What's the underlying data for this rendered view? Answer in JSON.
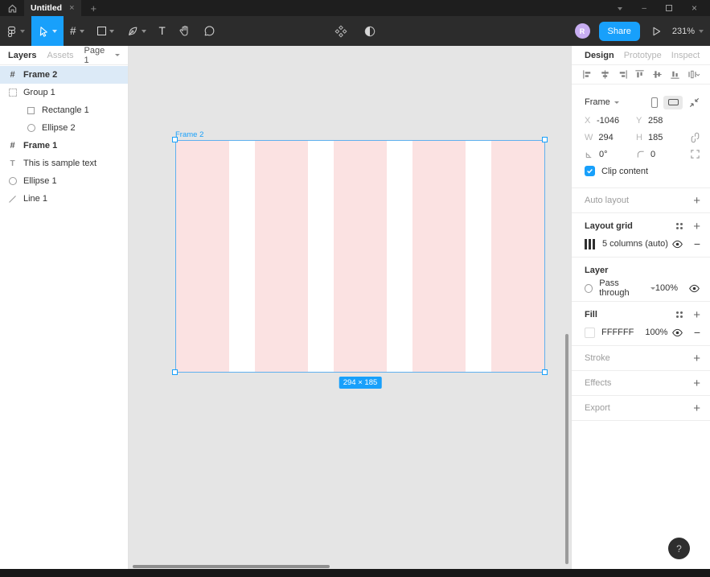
{
  "tabbar": {
    "tab_title": "Untitled",
    "close_glyph": "×",
    "new_tab_glyph": "+"
  },
  "window_controls": {
    "minimize_glyph": "–",
    "close_glyph": "×"
  },
  "toolbar": {
    "frame_tool_glyph": "#",
    "text_tool_glyph": "T",
    "avatar_initial": "R",
    "share_label": "Share",
    "zoom_level": "231%"
  },
  "left_panel": {
    "tab_layers": "Layers",
    "tab_assets": "Assets",
    "page_selector": "Page 1",
    "layers": [
      {
        "name": "Frame 2",
        "type": "frame",
        "selected": true,
        "indent": 0
      },
      {
        "name": "Group 1",
        "type": "group",
        "selected": false,
        "indent": 0
      },
      {
        "name": "Rectangle 1",
        "type": "rectangle",
        "selected": false,
        "indent": 1
      },
      {
        "name": "Ellipse 2",
        "type": "ellipse",
        "selected": false,
        "indent": 1
      },
      {
        "name": "Frame 1",
        "type": "frame",
        "selected": false,
        "indent": 0
      },
      {
        "name": "This is sample text",
        "type": "text",
        "selected": false,
        "indent": 0
      },
      {
        "name": "Ellipse 1",
        "type": "ellipse",
        "selected": false,
        "indent": 0
      },
      {
        "name": "Line 1",
        "type": "line",
        "selected": false,
        "indent": 0
      }
    ]
  },
  "canvas": {
    "frame_label": "Frame 2",
    "size_badge": "294 × 185",
    "grid_columns": 5
  },
  "inspector": {
    "tabs": {
      "design": "Design",
      "prototype": "Prototype",
      "inspect": "Inspect"
    },
    "frame": {
      "type_label": "Frame",
      "x_label": "X",
      "x": "-1046",
      "y_label": "Y",
      "y": "258",
      "w_label": "W",
      "w": "294",
      "h_label": "H",
      "h": "185",
      "rotation": "0°",
      "radius": "0",
      "clip_label": "Clip content"
    },
    "auto_layout": {
      "title": "Auto layout"
    },
    "layout_grid": {
      "title": "Layout grid",
      "item_label": "5 columns (auto)"
    },
    "layer": {
      "title": "Layer",
      "blend_mode": "Pass through",
      "opacity": "100%"
    },
    "fill": {
      "title": "Fill",
      "hex": "FFFFFF",
      "opacity": "100%"
    },
    "stroke": {
      "title": "Stroke"
    },
    "effects": {
      "title": "Effects"
    },
    "export": {
      "title": "Export"
    },
    "help_glyph": "?"
  },
  "colors": {
    "accent": "#18A0FB",
    "selected_row": "#DCEAF7",
    "grid_column_pink": "#FBE2E2",
    "toolbar_dark": "#2C2C2C",
    "canvas_gray": "#E5E5E5"
  }
}
